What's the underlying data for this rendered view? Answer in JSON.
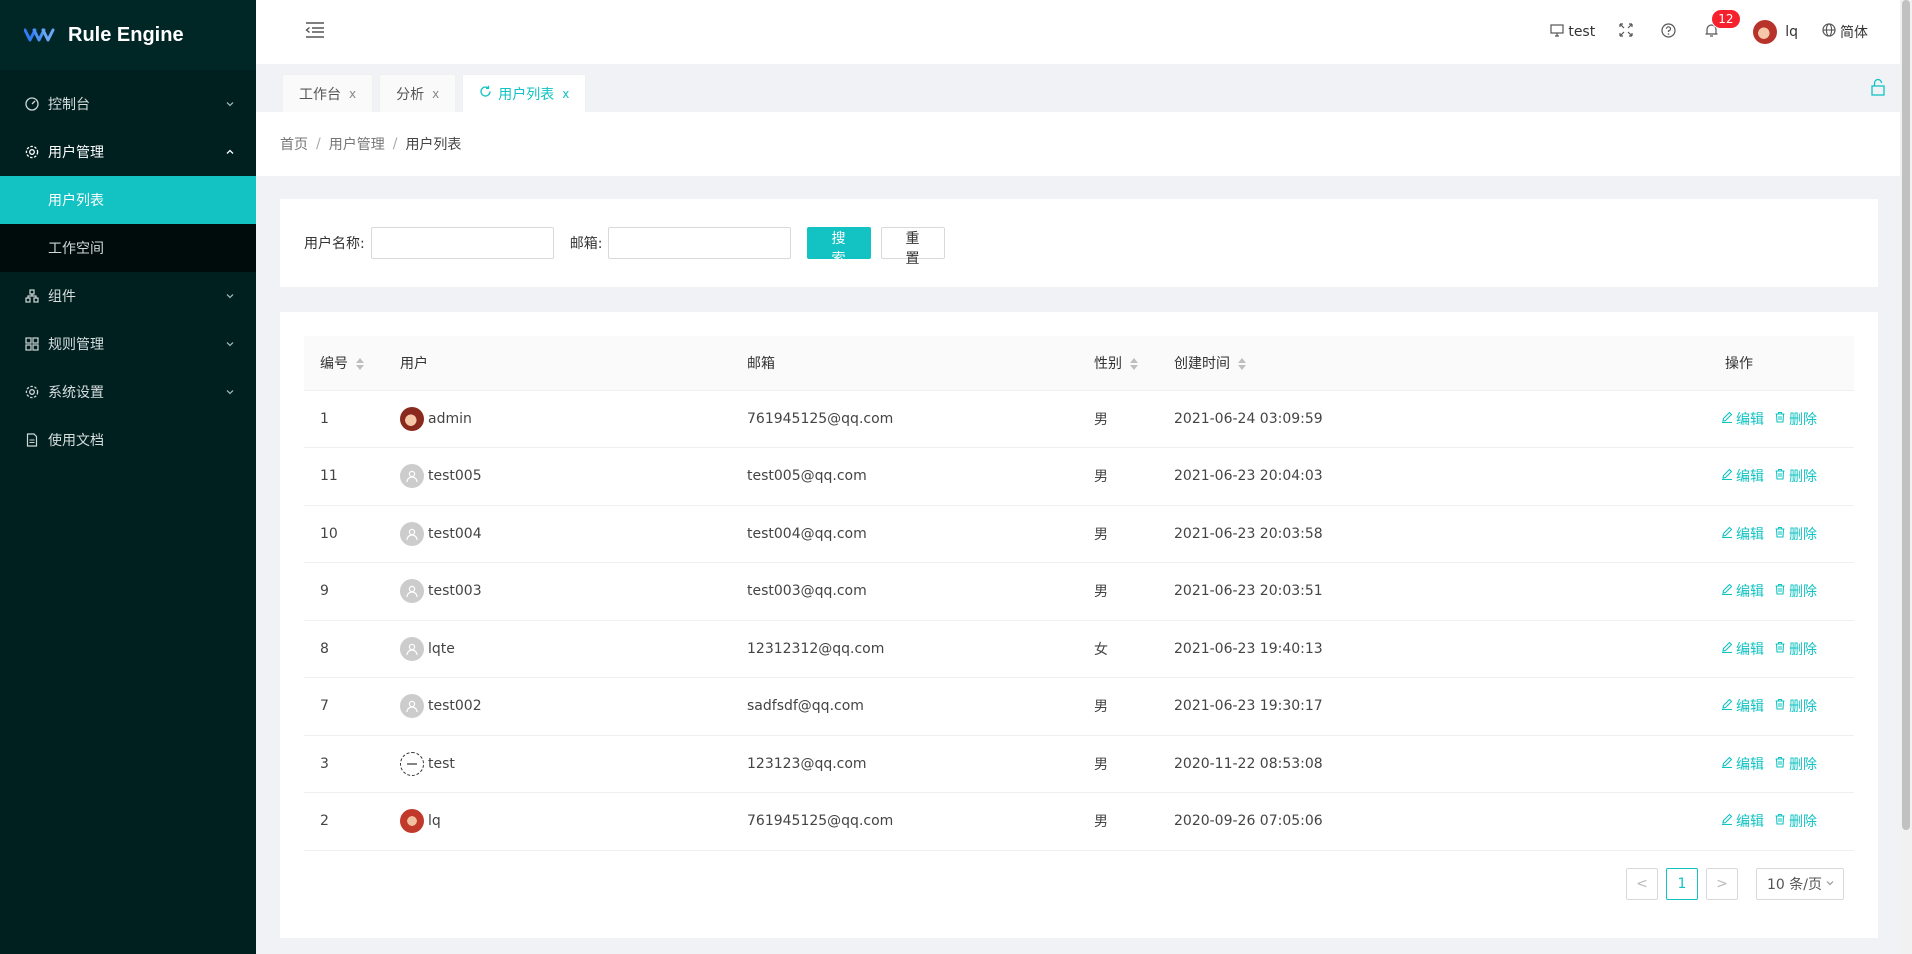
{
  "app": {
    "title": "Rule Engine"
  },
  "sidebar": {
    "items": [
      {
        "label": "控制台",
        "icon": "dashboard-icon",
        "expanded": false
      },
      {
        "label": "用户管理",
        "icon": "gear-icon",
        "expanded": true,
        "children": [
          {
            "label": "用户列表",
            "active": true
          },
          {
            "label": "工作空间",
            "active": false
          }
        ]
      },
      {
        "label": "组件",
        "icon": "cluster-icon",
        "expanded": false
      },
      {
        "label": "规则管理",
        "icon": "grid-icon",
        "expanded": false
      },
      {
        "label": "系统设置",
        "icon": "gear-icon",
        "expanded": false
      },
      {
        "label": "使用文档",
        "icon": "document-icon",
        "expanded": false
      }
    ]
  },
  "header": {
    "workspace": "test",
    "notification_count": "12",
    "username": "lq",
    "language": "简体"
  },
  "tabs": [
    {
      "label": "工作台",
      "close": "x",
      "active": false
    },
    {
      "label": "分析",
      "close": "x",
      "active": false
    },
    {
      "label": "用户列表",
      "close": "x",
      "active": true
    }
  ],
  "breadcrumb": [
    "首页",
    "用户管理",
    "用户列表"
  ],
  "breadcrumb_sep": "/",
  "search": {
    "username_label": "用户名称:",
    "username_value": "",
    "email_label": "邮箱:",
    "email_value": "",
    "search_button": "搜 索",
    "reset_button": "重 置"
  },
  "table": {
    "columns": {
      "id": "编号",
      "user": "用户",
      "email": "邮箱",
      "gender": "性别",
      "created": "创建时间",
      "actions": "操作"
    },
    "edit_label": "编辑",
    "delete_label": "删除",
    "rows": [
      {
        "id": "1",
        "user": "admin",
        "avatar": "photo",
        "email": "761945125@qq.com",
        "gender": "男",
        "created": "2021-06-24 03:09:59"
      },
      {
        "id": "11",
        "user": "test005",
        "avatar": "default",
        "email": "test005@qq.com",
        "gender": "男",
        "created": "2021-06-23 20:04:03"
      },
      {
        "id": "10",
        "user": "test004",
        "avatar": "default",
        "email": "test004@qq.com",
        "gender": "男",
        "created": "2021-06-23 20:03:58"
      },
      {
        "id": "9",
        "user": "test003",
        "avatar": "default",
        "email": "test003@qq.com",
        "gender": "男",
        "created": "2021-06-23 20:03:51"
      },
      {
        "id": "8",
        "user": "lqte",
        "avatar": "default",
        "email": "12312312@qq.com",
        "gender": "女",
        "created": "2021-06-23 19:40:13"
      },
      {
        "id": "7",
        "user": "test002",
        "avatar": "default",
        "email": "sadfsdf@qq.com",
        "gender": "男",
        "created": "2021-06-23 19:30:17"
      },
      {
        "id": "3",
        "user": "test",
        "avatar": "dashed",
        "email": "123123@qq.com",
        "gender": "男",
        "created": "2020-11-22 08:53:08"
      },
      {
        "id": "2",
        "user": "lq",
        "avatar": "photo2",
        "email": "761945125@qq.com",
        "gender": "男",
        "created": "2020-09-26 07:05:06"
      }
    ]
  },
  "pagination": {
    "prev": "<",
    "current_page": "1",
    "next": ">",
    "page_size": "10 条/页"
  },
  "colors": {
    "primary": "#13c2c2",
    "sidebar_bg": "#001f1f",
    "badge": "#f5222d"
  }
}
